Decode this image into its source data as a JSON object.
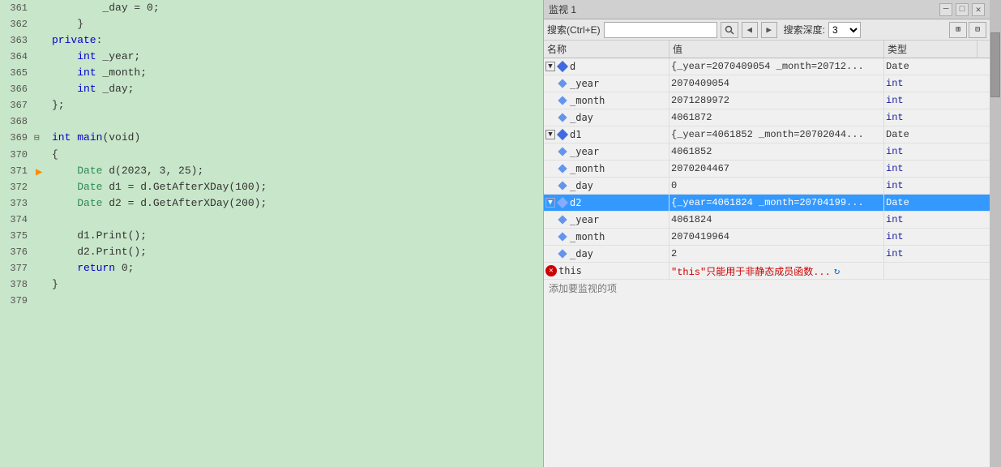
{
  "editor": {
    "lines": [
      {
        "num": "361",
        "indent": 4,
        "content": "    _day = 0;",
        "hasArrow": false,
        "highlighted": false
      },
      {
        "num": "362",
        "indent": 2,
        "content": "  }",
        "hasArrow": false,
        "highlighted": false
      },
      {
        "num": "363",
        "indent": 1,
        "content": "private:",
        "hasArrow": false,
        "highlighted": false
      },
      {
        "num": "364",
        "indent": 2,
        "content": "  int _year;",
        "hasArrow": false,
        "highlighted": false
      },
      {
        "num": "365",
        "indent": 2,
        "content": "  int _month;",
        "hasArrow": false,
        "highlighted": false
      },
      {
        "num": "366",
        "indent": 2,
        "content": "  int _day;",
        "hasArrow": false,
        "highlighted": false
      },
      {
        "num": "367",
        "indent": 1,
        "content": "};",
        "hasArrow": false,
        "highlighted": false
      },
      {
        "num": "368",
        "indent": 0,
        "content": "",
        "hasArrow": false,
        "highlighted": false
      },
      {
        "num": "369",
        "indent": 0,
        "content": "int main(void)",
        "hasArrow": false,
        "highlighted": false,
        "hasExpander": true
      },
      {
        "num": "370",
        "indent": 0,
        "content": "{",
        "hasArrow": false,
        "highlighted": false
      },
      {
        "num": "371",
        "indent": 2,
        "content": "  Date d(2023, 3, 25);",
        "hasArrow": false,
        "highlighted": false
      },
      {
        "num": "372",
        "indent": 2,
        "content": "  Date d1 = d.GetAfterXDay(100);",
        "hasArrow": false,
        "highlighted": false
      },
      {
        "num": "373",
        "indent": 2,
        "content": "  Date d2 = d.GetAfterXDay(200);",
        "hasArrow": false,
        "highlighted": false
      },
      {
        "num": "374",
        "indent": 0,
        "content": "",
        "hasArrow": false,
        "highlighted": false
      },
      {
        "num": "375",
        "indent": 2,
        "content": "  d1.Print();",
        "hasArrow": false,
        "highlighted": false
      },
      {
        "num": "376",
        "indent": 2,
        "content": "  d2.Print();",
        "hasArrow": false,
        "highlighted": false
      },
      {
        "num": "377",
        "indent": 2,
        "content": "  return 0;",
        "hasArrow": false,
        "highlighted": false
      },
      {
        "num": "378",
        "indent": 1,
        "content": "}",
        "hasArrow": false,
        "highlighted": false
      },
      {
        "num": "379",
        "indent": 0,
        "content": "",
        "hasArrow": false,
        "highlighted": false
      }
    ]
  },
  "watch": {
    "title": "监视 1",
    "toolbar": {
      "search_label": "搜索(Ctrl+E)",
      "search_placeholder": "",
      "depth_label": "搜索深度:",
      "depth_value": "3"
    },
    "columns": {
      "name": "名称",
      "value": "值",
      "type": "类型"
    },
    "rows": [
      {
        "id": "d",
        "level": 0,
        "expanded": true,
        "name": "d",
        "value": "{_year=2070409054 _month=20712...",
        "type": "Date",
        "selected": false,
        "icon": "diamond"
      },
      {
        "id": "d._year",
        "level": 1,
        "expanded": false,
        "name": "_year",
        "value": "2070409054",
        "type": "int",
        "selected": false,
        "icon": "small-diamond"
      },
      {
        "id": "d._month",
        "level": 1,
        "expanded": false,
        "name": "_month",
        "value": "2071289972",
        "type": "int",
        "selected": false,
        "icon": "small-diamond"
      },
      {
        "id": "d._day",
        "level": 1,
        "expanded": false,
        "name": "_day",
        "value": "4061872",
        "type": "int",
        "selected": false,
        "icon": "small-diamond"
      },
      {
        "id": "d1",
        "level": 0,
        "expanded": true,
        "name": "d1",
        "value": "{_year=4061852 _month=20702044...",
        "type": "Date",
        "selected": false,
        "icon": "diamond"
      },
      {
        "id": "d1._year",
        "level": 1,
        "expanded": false,
        "name": "_year",
        "value": "4061852",
        "type": "int",
        "selected": false,
        "icon": "small-diamond"
      },
      {
        "id": "d1._month",
        "level": 1,
        "expanded": false,
        "name": "_month",
        "value": "2070204467",
        "type": "int",
        "selected": false,
        "icon": "small-diamond"
      },
      {
        "id": "d1._day",
        "level": 1,
        "expanded": false,
        "name": "_day",
        "value": "0",
        "type": "int",
        "selected": false,
        "icon": "small-diamond"
      },
      {
        "id": "d2",
        "level": 0,
        "expanded": true,
        "name": "d2",
        "value": "{_year=4061824 _month=20704199...",
        "type": "Date",
        "selected": true,
        "icon": "diamond"
      },
      {
        "id": "d2._year",
        "level": 1,
        "expanded": false,
        "name": "_year",
        "value": "4061824",
        "type": "int",
        "selected": false,
        "icon": "small-diamond"
      },
      {
        "id": "d2._month",
        "level": 1,
        "expanded": false,
        "name": "_month",
        "value": "2070419964",
        "type": "int",
        "selected": false,
        "icon": "small-diamond"
      },
      {
        "id": "d2._day",
        "level": 1,
        "expanded": false,
        "name": "_day",
        "value": "2",
        "type": "int",
        "selected": false,
        "icon": "small-diamond"
      },
      {
        "id": "this",
        "level": 0,
        "expanded": false,
        "name": "this",
        "value": "\"this\"只能用于非静态成员函数...",
        "type": "",
        "selected": false,
        "icon": "error"
      }
    ],
    "add_watch_label": "添加要监视的项"
  }
}
